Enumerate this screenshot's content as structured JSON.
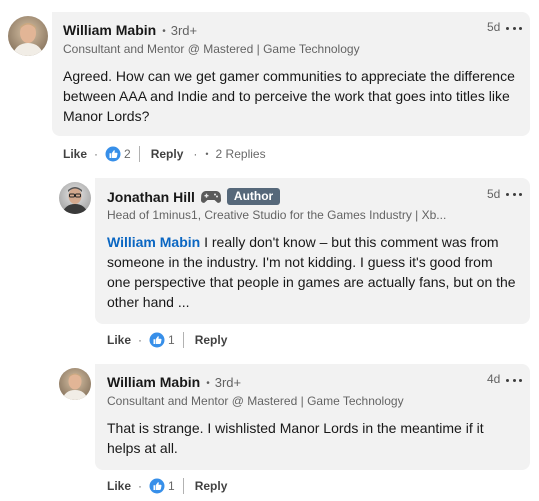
{
  "comments": [
    {
      "author": "William Mabin",
      "degree": "3rd+",
      "headline": "Consultant and Mentor @ Mastered | Game Technology",
      "age": "5d",
      "text": "Agreed. How can we get gamer communities to appreciate the difference between AAA and Indie and to perceive the work that goes into titles like Manor Lords?",
      "like_label": "Like",
      "reaction_count": "2",
      "reply_label": "Reply",
      "replies_label": "2 Replies"
    },
    {
      "author": "Jonathan Hill",
      "author_badge": "Author",
      "headline": "Head of 1minus1, Creative Studio for the Games Industry | Xb...",
      "age": "5d",
      "mention": "William Mabin",
      "text": " I really don't know – but this comment was from someone in the industry. I'm not kidding. I guess it's good from one perspective that people in games are actually fans, but on the other hand ...",
      "like_label": "Like",
      "reaction_count": "1",
      "reply_label": "Reply"
    },
    {
      "author": "William Mabin",
      "degree": "3rd+",
      "headline": "Consultant and Mentor @ Mastered | Game Technology",
      "age": "4d",
      "text": "That is strange. I wishlisted Manor Lords in the meantime if it helps at all.",
      "like_label": "Like",
      "reaction_count": "1",
      "reply_label": "Reply"
    }
  ],
  "icons": {
    "more": "more-options-icon",
    "like": "like-reaction-icon",
    "gamepad": "gamepad-emoji-icon"
  },
  "colors": {
    "bubble": "#f2f2f2",
    "mention": "#0a66c2",
    "badge": "#56687a",
    "like_blue": "#378fe9"
  }
}
